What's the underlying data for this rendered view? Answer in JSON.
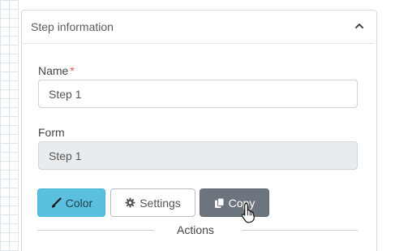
{
  "panel": {
    "title": "Step information",
    "collapse_icon": "chevron-up-icon"
  },
  "name_field": {
    "label": "Name",
    "required_mark": "*",
    "value": "Step 1"
  },
  "form_field": {
    "label": "Form",
    "value": "Step 1",
    "disabled": true
  },
  "buttons": {
    "color": {
      "label": "Color",
      "icon": "paint-brush-icon",
      "bg": "#5bc0de"
    },
    "settings": {
      "label": "Settings",
      "icon": "gear-icon"
    },
    "copy": {
      "label": "Copy",
      "icon": "copy-icon",
      "bg": "#6c757d"
    }
  },
  "actions_divider": {
    "label": "Actions"
  },
  "cursor": {
    "icon": "hand-pointer-icon"
  }
}
